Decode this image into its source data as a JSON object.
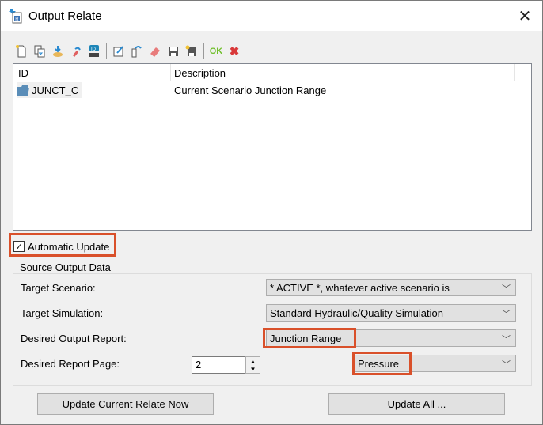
{
  "window": {
    "title": "Output Relate",
    "close_icon": "close-icon"
  },
  "toolbar": {
    "icons": [
      "new-icon",
      "copy-icon",
      "import-icon",
      "undo-delete-icon",
      "id-tag-icon",
      "edit-icon",
      "rename-icon",
      "eraser-icon",
      "save-icon",
      "save-new-icon"
    ],
    "ok_label": "OK",
    "cancel_label": "✖"
  },
  "list": {
    "columns": [
      "ID",
      "Description"
    ],
    "rows": [
      {
        "id": "JUNCT_C",
        "description": "Current Scenario Junction Range"
      }
    ]
  },
  "automatic_update": {
    "label": "Automatic Update",
    "checked": true,
    "check_glyph": "✓"
  },
  "source": {
    "group_title": "Source Output Data",
    "target_scenario_label": "Target Scenario:",
    "target_scenario_value": "* ACTIVE *, whatever active scenario is",
    "target_simulation_label": "Target Simulation:",
    "target_simulation_value": "Standard Hydraulic/Quality Simulation",
    "output_report_label": "Desired Output Report:",
    "output_report_value": "Junction Range",
    "report_page_label": "Desired Report Page:",
    "report_page_value": "2",
    "page_field_value": "Pressure",
    "dropdown_arrow": "﹀"
  },
  "buttons": {
    "update_current": "Update Current Relate Now",
    "update_all": "Update All ..."
  },
  "colors": {
    "highlight": "#d9502a"
  }
}
